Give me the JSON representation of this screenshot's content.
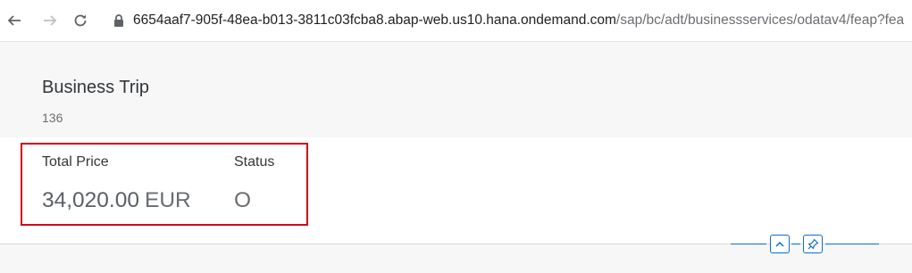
{
  "browser": {
    "url_host": "6654aaf7-905f-48ea-b013-3811c03fcba8.abap-web.us10.hana.ondemand.com",
    "url_path": "/sap/bc/adt/businessservices/odatav4/feap?fea"
  },
  "header": {
    "title": "Business Trip",
    "subtitle": "136"
  },
  "kpis": {
    "total_price_label": "Total Price",
    "total_price_value": "34,020.00",
    "total_price_unit": "EUR",
    "status_label": "Status",
    "status_value": "O"
  },
  "colors": {
    "accent": "#0a6ed1",
    "highlight": "#d0021b"
  }
}
